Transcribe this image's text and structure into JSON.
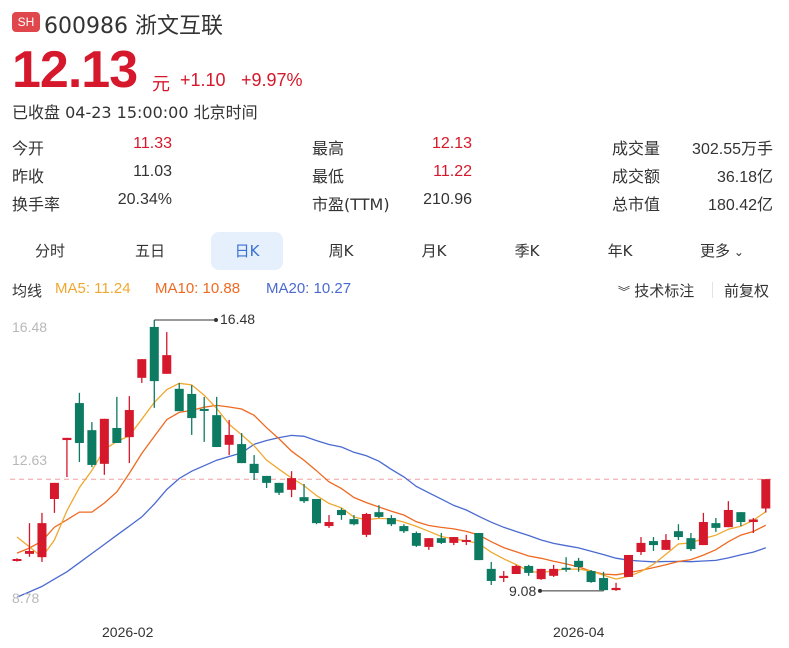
{
  "header": {
    "exchange": "SH",
    "code_name": "600986 浙文互联",
    "price": "12.13",
    "unit": "元",
    "change": "+1.10",
    "change_pct": "+9.97%",
    "status": "已收盘 04-23 15:00:00 北京时间"
  },
  "stats": [
    {
      "label": "今开",
      "value": "11.33",
      "color": "red"
    },
    {
      "label": "最高",
      "value": "12.13",
      "color": "red"
    },
    {
      "label": "成交量",
      "value": "302.55万手",
      "color": "dark"
    },
    {
      "label": "昨收",
      "value": "11.03",
      "color": "dark"
    },
    {
      "label": "最低",
      "value": "11.22",
      "color": "red"
    },
    {
      "label": "成交额",
      "value": "36.18亿",
      "color": "dark"
    },
    {
      "label": "换手率",
      "value": "20.34%",
      "color": "dark"
    },
    {
      "label": "市盈(TTM)",
      "value": "210.96",
      "color": "dark"
    },
    {
      "label": "总市值",
      "value": "180.42亿",
      "color": "dark"
    }
  ],
  "tabs": [
    "分时",
    "五日",
    "日K",
    "周K",
    "月K",
    "季K",
    "年K",
    "更多"
  ],
  "active_tab": "日K",
  "ma_legend": {
    "label": "均线",
    "ma5": "MA5: 11.24",
    "ma10": "MA10: 10.88",
    "ma20": "MA20: 10.27",
    "tech": "技术标注",
    "adjust": "前复权"
  },
  "colors": {
    "up": "#d5182b",
    "down": "#0d7a62",
    "ma5": "#f0a830",
    "ma10": "#ee6a22",
    "ma20": "#4a6ad0"
  },
  "chart_data": {
    "type": "candlestick",
    "y_ticks": [
      "16.48",
      "12.63",
      "8.78"
    ],
    "ylim": [
      8.78,
      16.48
    ],
    "x_labels": [
      {
        "index": 9,
        "label": "2026-02"
      },
      {
        "index": 45,
        "label": "2026-04"
      }
    ],
    "max_label": "16.48",
    "min_label": "9.08",
    "last_close_line": 12.13,
    "ohlc": [
      [
        9.93,
        9.97,
        9.88,
        9.95
      ],
      [
        10.09,
        10.93,
        10.01,
        10.17
      ],
      [
        10.0,
        11.21,
        9.87,
        10.93
      ],
      [
        11.59,
        12.03,
        11.21,
        12.03
      ],
      [
        13.2,
        13.26,
        12.19,
        13.26
      ],
      [
        14.21,
        14.49,
        12.6,
        13.12
      ],
      [
        13.47,
        13.69,
        12.46,
        12.52
      ],
      [
        12.55,
        13.78,
        12.25,
        13.78
      ],
      [
        13.53,
        14.38,
        13.12,
        13.12
      ],
      [
        13.28,
        14.4,
        12.57,
        14.02
      ],
      [
        14.9,
        15.41,
        14.76,
        15.41
      ],
      [
        16.29,
        16.48,
        14.08,
        14.81
      ],
      [
        15.01,
        16.15,
        15.01,
        15.52
      ],
      [
        14.6,
        14.76,
        14.0,
        13.99
      ],
      [
        14.46,
        14.7,
        13.34,
        13.8
      ],
      [
        14.05,
        14.38,
        13.15,
        14.0
      ],
      [
        13.88,
        14.38,
        13.01,
        13.01
      ],
      [
        13.07,
        13.75,
        12.79,
        13.34
      ],
      [
        13.09,
        13.39,
        12.57,
        12.57
      ],
      [
        12.55,
        12.79,
        12.11,
        12.3
      ],
      [
        12.22,
        12.22,
        11.89,
        12.03
      ],
      [
        12.03,
        12.03,
        11.7,
        11.76
      ],
      [
        11.84,
        12.35,
        11.64,
        12.16
      ],
      [
        11.64,
        12.0,
        11.48,
        11.53
      ],
      [
        11.59,
        11.59,
        10.9,
        10.93
      ],
      [
        10.85,
        11.15,
        10.8,
        10.96
      ],
      [
        11.29,
        11.34,
        11.02,
        11.15
      ],
      [
        11.04,
        11.15,
        10.87,
        10.9
      ],
      [
        10.61,
        11.21,
        10.55,
        11.18
      ],
      [
        11.23,
        11.42,
        11.07,
        11.1
      ],
      [
        11.07,
        11.15,
        10.85,
        10.9
      ],
      [
        10.85,
        10.9,
        10.66,
        10.71
      ],
      [
        10.66,
        10.7,
        10.28,
        10.31
      ],
      [
        10.28,
        10.52,
        10.2,
        10.52
      ],
      [
        10.52,
        10.66,
        10.36,
        10.39
      ],
      [
        10.39,
        10.55,
        10.33,
        10.55
      ],
      [
        10.44,
        10.61,
        10.33,
        10.47
      ],
      [
        10.66,
        10.66,
        9.92,
        9.92
      ],
      [
        9.68,
        9.87,
        9.24,
        9.35
      ],
      [
        9.43,
        9.62,
        9.32,
        9.49
      ],
      [
        9.54,
        9.79,
        9.54,
        9.76
      ],
      [
        9.76,
        9.79,
        9.49,
        9.57
      ],
      [
        9.4,
        9.68,
        9.38,
        9.68
      ],
      [
        9.49,
        9.79,
        9.46,
        9.68
      ],
      [
        9.71,
        10.0,
        9.6,
        9.7
      ],
      [
        9.9,
        9.98,
        9.6,
        9.73
      ],
      [
        9.62,
        9.65,
        9.3,
        9.32
      ],
      [
        9.43,
        9.6,
        9.08,
        9.1
      ],
      [
        9.1,
        9.3,
        9.08,
        9.16
      ],
      [
        9.46,
        10.06,
        9.46,
        10.06
      ],
      [
        10.14,
        10.55,
        10.06,
        10.39
      ],
      [
        10.44,
        10.55,
        10.17,
        10.33
      ],
      [
        10.2,
        10.63,
        10.2,
        10.47
      ],
      [
        10.71,
        10.9,
        10.47,
        10.55
      ],
      [
        10.52,
        10.66,
        10.17,
        10.22
      ],
      [
        10.33,
        11.21,
        10.33,
        10.96
      ],
      [
        10.93,
        11.07,
        10.69,
        10.8
      ],
      [
        10.82,
        11.53,
        10.82,
        11.29
      ],
      [
        11.23,
        11.23,
        10.85,
        10.96
      ],
      [
        10.96,
        11.07,
        10.66,
        11.03
      ],
      [
        11.33,
        12.13,
        11.22,
        12.13
      ]
    ],
    "ma5_head": [
      10.55,
      10.28,
      10.0,
      10.47
    ],
    "ma10_head": [
      10.11,
      10.25,
      10.44,
      10.82,
      11.02,
      11.23,
      11.23,
      11.48,
      11.78
    ],
    "ma20_head": [
      8.91,
      9.05,
      9.2,
      9.4,
      9.6,
      9.85,
      10.1,
      10.35,
      10.6,
      10.85,
      11.1,
      11.45,
      11.85,
      12.15,
      12.35,
      12.5,
      12.65,
      12.75,
      12.85
    ]
  }
}
